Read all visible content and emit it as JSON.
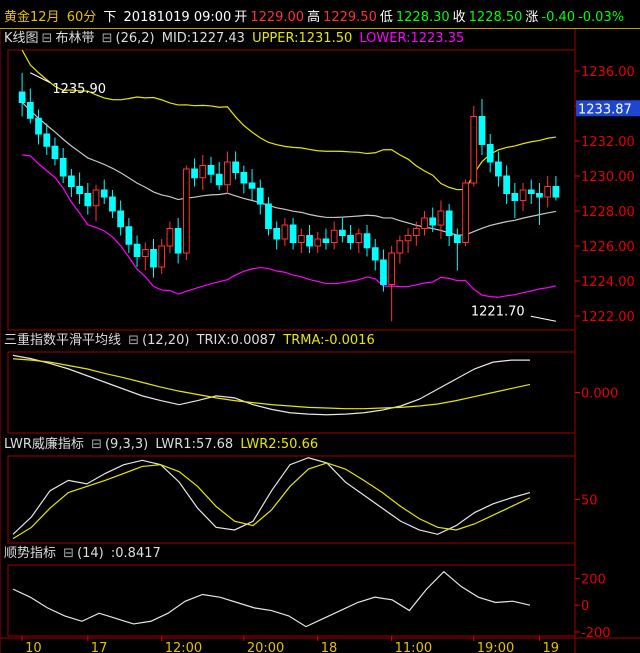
{
  "quote": {
    "name": "黄金12月",
    "period": "60分",
    "direction": "下",
    "datetime": "20181019 09:00",
    "open_label": "开",
    "open": "1229.00",
    "high_label": "高",
    "high": "1229.50",
    "low_label": "低",
    "low": "1228.30",
    "close_label": "收",
    "close": "1228.50",
    "change_label": "涨",
    "change": "-0.40",
    "pct": "-0.03%"
  },
  "panels": {
    "kline": {
      "title": "K线图",
      "sub": "布林带",
      "params": "(26,2)",
      "mid": "MID:1227.43",
      "upper": "UPPER:1231.50",
      "lower": "LOWER:1223.35"
    },
    "trix": {
      "title": "三重指数平滑平均线",
      "params": "(12,20)",
      "trix": "TRIX:0.0087",
      "trma": "TRMA:-0.0016"
    },
    "lwr": {
      "title": "LWR威廉指标",
      "params": "(9,3,3)",
      "lwr1": "LWR1:57.68",
      "lwr2": "LWR2:50.66"
    },
    "cci": {
      "title": "顺势指标",
      "params": "(14)",
      "value": ":0.8417"
    }
  },
  "colors": {
    "up": "#ff3232",
    "down": "#00ffff",
    "mid": "#c8c8c8",
    "upper": "#e6e600",
    "lower": "#ff00ff",
    "axis": "#e60000"
  },
  "chart_data": [
    {
      "type": "candlestick",
      "ylim": [
        1221.2,
        1237.2
      ],
      "yticks": [
        "1236.00",
        "1234.00",
        "1232.00",
        "1230.00",
        "1228.00",
        "1226.00",
        "1224.00",
        "1222.00"
      ],
      "current_price": "1233.87",
      "annotations": [
        {
          "text": "1235.90",
          "index": 1,
          "value": 1235.9
        },
        {
          "text": "1221.70",
          "index": 65,
          "value": 1221.7
        }
      ],
      "candles": [
        [
          1234.8,
          1235.9,
          1233.4,
          1234.2
        ],
        [
          1234.2,
          1235.0,
          1233.0,
          1233.3
        ],
        [
          1233.3,
          1233.8,
          1231.8,
          1232.4
        ],
        [
          1232.4,
          1233.0,
          1231.2,
          1231.7
        ],
        [
          1231.7,
          1232.2,
          1230.6,
          1231.0
        ],
        [
          1231.0,
          1231.6,
          1229.6,
          1230.0
        ],
        [
          1230.0,
          1230.4,
          1228.8,
          1229.4
        ],
        [
          1229.4,
          1230.2,
          1228.4,
          1229.0
        ],
        [
          1229.0,
          1229.6,
          1227.8,
          1228.3
        ],
        [
          1228.3,
          1229.5,
          1227.4,
          1229.2
        ],
        [
          1229.2,
          1229.8,
          1228.4,
          1228.8
        ],
        [
          1228.8,
          1229.2,
          1227.6,
          1228.0
        ],
        [
          1228.0,
          1228.6,
          1226.6,
          1227.1
        ],
        [
          1227.1,
          1227.6,
          1225.6,
          1226.1
        ],
        [
          1226.1,
          1226.6,
          1224.8,
          1225.4
        ],
        [
          1225.4,
          1226.2,
          1224.6,
          1225.8
        ],
        [
          1225.8,
          1226.4,
          1224.2,
          1224.8
        ],
        [
          1224.8,
          1226.4,
          1224.4,
          1226.0
        ],
        [
          1226.0,
          1227.4,
          1225.6,
          1227.0
        ],
        [
          1227.0,
          1227.6,
          1225.0,
          1225.6
        ],
        [
          1225.6,
          1230.6,
          1225.2,
          1230.4
        ],
        [
          1230.4,
          1231.0,
          1229.4,
          1229.9
        ],
        [
          1229.9,
          1231.2,
          1229.2,
          1230.6
        ],
        [
          1230.6,
          1231.1,
          1229.6,
          1230.1
        ],
        [
          1230.1,
          1230.8,
          1229.2,
          1229.5
        ],
        [
          1229.5,
          1231.4,
          1229.0,
          1230.8
        ],
        [
          1230.8,
          1231.4,
          1229.8,
          1230.2
        ],
        [
          1230.2,
          1230.6,
          1229.0,
          1229.6
        ],
        [
          1229.6,
          1230.4,
          1228.6,
          1229.3
        ],
        [
          1229.3,
          1229.8,
          1227.8,
          1228.4
        ],
        [
          1228.4,
          1228.8,
          1226.6,
          1227.0
        ],
        [
          1227.0,
          1227.4,
          1225.8,
          1226.4
        ],
        [
          1226.4,
          1227.6,
          1226.0,
          1227.2
        ],
        [
          1227.2,
          1227.6,
          1225.8,
          1226.2
        ],
        [
          1226.2,
          1227.0,
          1225.6,
          1226.6
        ],
        [
          1226.6,
          1227.2,
          1225.6,
          1226.0
        ],
        [
          1226.0,
          1226.8,
          1225.6,
          1226.4
        ],
        [
          1226.4,
          1227.0,
          1225.8,
          1226.2
        ],
        [
          1226.2,
          1227.4,
          1225.8,
          1226.9
        ],
        [
          1226.9,
          1227.6,
          1226.2,
          1226.6
        ],
        [
          1226.6,
          1227.2,
          1225.8,
          1226.2
        ],
        [
          1226.2,
          1227.0,
          1225.6,
          1226.7
        ],
        [
          1226.7,
          1227.2,
          1225.4,
          1225.9
        ],
        [
          1225.9,
          1226.4,
          1224.6,
          1225.2
        ],
        [
          1225.2,
          1225.8,
          1223.4,
          1223.8
        ],
        [
          1223.8,
          1226.0,
          1221.7,
          1225.6
        ],
        [
          1225.6,
          1226.6,
          1225.0,
          1226.3
        ],
        [
          1226.3,
          1227.0,
          1225.6,
          1226.6
        ],
        [
          1226.6,
          1227.4,
          1226.0,
          1227.0
        ],
        [
          1227.0,
          1228.0,
          1226.6,
          1227.6
        ],
        [
          1227.6,
          1228.2,
          1226.8,
          1227.2
        ],
        [
          1227.2,
          1228.6,
          1226.4,
          1228.0
        ],
        [
          1228.0,
          1228.4,
          1226.0,
          1226.6
        ],
        [
          1226.6,
          1227.0,
          1224.6,
          1226.2
        ],
        [
          1226.2,
          1229.8,
          1226.0,
          1229.6
        ],
        [
          1229.6,
          1234.0,
          1229.4,
          1233.4
        ],
        [
          1233.4,
          1234.4,
          1231.2,
          1231.8
        ],
        [
          1231.8,
          1232.4,
          1230.2,
          1230.8
        ],
        [
          1230.8,
          1231.4,
          1229.4,
          1230.0
        ],
        [
          1230.0,
          1230.6,
          1228.4,
          1229.0
        ],
        [
          1229.0,
          1229.6,
          1227.6,
          1228.6
        ],
        [
          1228.6,
          1229.6,
          1228.0,
          1229.2
        ],
        [
          1229.2,
          1229.8,
          1228.4,
          1229.0
        ],
        [
          1229.0,
          1229.6,
          1227.2,
          1228.8
        ],
        [
          1228.8,
          1230.0,
          1228.2,
          1229.4
        ],
        [
          1229.4,
          1230.0,
          1228.6,
          1228.8
        ]
      ]
    },
    {
      "type": "line",
      "name": "trix",
      "yticks": [
        "0.000"
      ],
      "ylim": [
        -0.6,
        0.6
      ],
      "series": [
        {
          "name": "TRIX",
          "values": [
            0.55,
            0.5,
            0.43,
            0.35,
            0.25,
            0.15,
            0.05,
            -0.05,
            -0.12,
            -0.18,
            -0.12,
            -0.05,
            -0.08,
            -0.18,
            -0.25,
            -0.3,
            -0.32,
            -0.33,
            -0.32,
            -0.3,
            -0.26,
            -0.2,
            -0.1,
            0.05,
            0.2,
            0.35,
            0.45,
            0.48,
            0.48
          ]
        },
        {
          "name": "TRMA",
          "values": [
            0.5,
            0.48,
            0.45,
            0.4,
            0.35,
            0.28,
            0.22,
            0.15,
            0.08,
            0.02,
            -0.03,
            -0.08,
            -0.12,
            -0.15,
            -0.18,
            -0.2,
            -0.22,
            -0.23,
            -0.24,
            -0.24,
            -0.23,
            -0.22,
            -0.2,
            -0.17,
            -0.12,
            -0.06,
            0.0,
            0.06,
            0.12
          ]
        }
      ]
    },
    {
      "type": "line",
      "name": "lwr",
      "yticks": [
        "50"
      ],
      "ylim": [
        0,
        100
      ],
      "series": [
        {
          "name": "LWR1",
          "values": [
            10,
            30,
            60,
            72,
            68,
            80,
            90,
            95,
            90,
            70,
            40,
            18,
            15,
            25,
            60,
            90,
            98,
            92,
            70,
            55,
            40,
            25,
            15,
            10,
            20,
            35,
            45,
            52,
            58
          ]
        },
        {
          "name": "LWR2",
          "values": [
            5,
            18,
            40,
            58,
            65,
            72,
            80,
            88,
            90,
            82,
            65,
            42,
            25,
            20,
            38,
            65,
            85,
            92,
            85,
            72,
            58,
            42,
            28,
            18,
            15,
            22,
            32,
            42,
            52
          ]
        }
      ]
    },
    {
      "type": "line",
      "name": "cci",
      "yticks": [
        "200",
        "0",
        "-200"
      ],
      "ylim": [
        -230,
        300
      ],
      "series": [
        {
          "name": "CCI",
          "values": [
            120,
            60,
            -20,
            -80,
            -120,
            -60,
            -100,
            -140,
            -120,
            -60,
            30,
            80,
            60,
            20,
            -20,
            -40,
            -80,
            -160,
            -100,
            -40,
            20,
            60,
            40,
            -40,
            120,
            250,
            140,
            60,
            20,
            30,
            0
          ]
        }
      ]
    }
  ],
  "x_labels": [
    {
      "text": "10",
      "index": 0
    },
    {
      "text": "17",
      "index": 8
    },
    {
      "text": "12:00",
      "index": 17
    },
    {
      "text": "20:00",
      "index": 27
    },
    {
      "text": "18",
      "index": 36
    },
    {
      "text": "11:00",
      "index": 45
    },
    {
      "text": "19:00",
      "index": 55
    },
    {
      "text": "19",
      "index": 63
    }
  ]
}
